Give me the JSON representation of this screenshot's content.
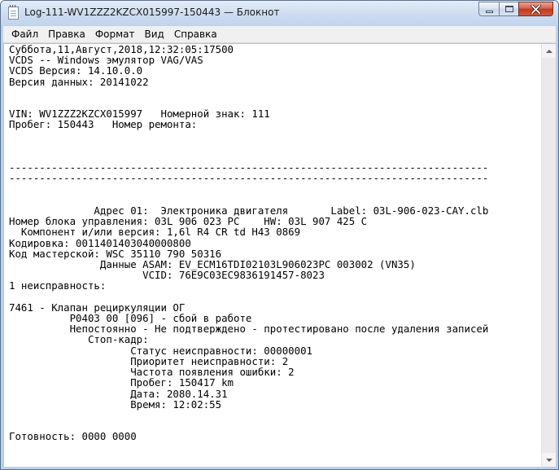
{
  "window": {
    "title": "Log-111-WV1ZZZ2KZCX015997-150443 — Блокнот"
  },
  "menu": {
    "items": [
      "Файл",
      "Правка",
      "Формат",
      "Вид",
      "Справка"
    ]
  },
  "editor": {
    "content": "Суббота,11,Август,2018,12:32:05:17500\nVCDS -- Windows эмулятор VAG/VAS\nVCDS Версия: 14.10.0.0\nВерсия данных: 20141022\n\n\nVIN: WV1ZZZ2KZCX015997   Номерной знак: 111\nПробег: 150443   Номер ремонта:\n\n\n\n-------------------------------------------------------------------------------\n-------------------------------------------------------------------------------\n\n\n              Адрес 01:  Электроника двигателя       Label: 03L-906-023-CAY.clb\nНомер блока управления: 03L 906 023 PC    HW: 03L 907 425 C\n  Компонент и/или версия: 1,6l R4 CR td H43 0869\nКодировка: 0011401403040000800\nКод мастерской: WSC 35110 790 50316\n               Данные ASAM: EV_ECM16TDI02103L906023PC 003002 (VN35)\n                      VCID: 76E9C03EC9836191457-8023\n1 неисправность:\n\n7461 - Клапан рециркуляции ОГ\n          P0403 00 [096] - сбой в работе\n          Непостоянно - Не подтверждено - протестировано после удаления записей\n             Стоп-кадр:\n                    Статус неисправности: 00000001\n                    Приоритет неисправности: 2\n                    Частота появления ошибки: 2\n                    Пробег: 150417 km\n                    Дата: 2080.14.31\n                    Время: 12:02:55\n\n\nГотовность: 0000 0000"
  }
}
